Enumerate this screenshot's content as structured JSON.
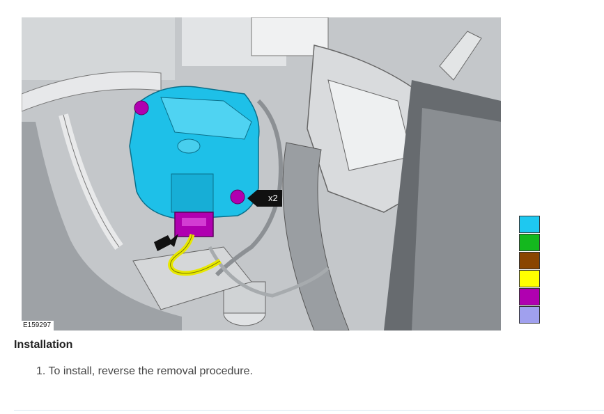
{
  "figure": {
    "id_label": "E159297",
    "callout_x2": "x2"
  },
  "legend": {
    "colors": [
      "#1ec8f0",
      "#14b81e",
      "#8a4500",
      "#ffff00",
      "#b000b0",
      "#a0a0ee"
    ]
  },
  "section": {
    "heading": "Installation",
    "steps": [
      {
        "text": "1. To install, reverse the removal procedure."
      }
    ]
  }
}
